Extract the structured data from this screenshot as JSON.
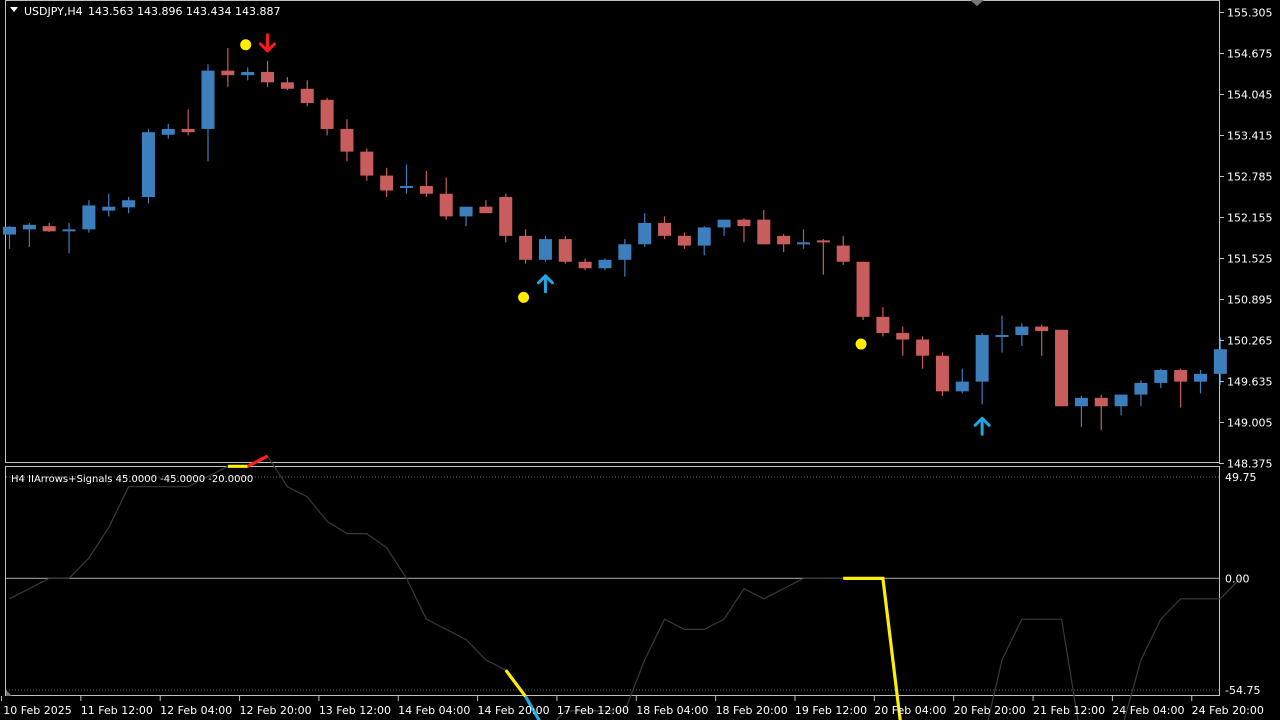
{
  "window": {
    "symbol_label": "USDJPY,H4",
    "ohlc_label": "143.563 143.896 143.434 143.887",
    "dropdown_icon": "triangle-down-icon"
  },
  "indicator": {
    "label": "H4 IIArrows+Signals 45.0000 -45.0000 -20.0000",
    "levels": [
      49.75,
      0,
      -54.75
    ],
    "level_labels": [
      "49.75",
      "0.00",
      "-54.75"
    ]
  },
  "colors": {
    "background": "#000000",
    "frame": "#c0c0c0",
    "bull": "#3d7ebd",
    "bear": "#c95c5c",
    "up_arrow": "#1ea7e1",
    "down_arrow": "#ff1a1a",
    "dot": "#ffee00",
    "osc_line": "#3a3a3a",
    "osc_yellow": "#ffee00",
    "osc_red": "#ff2020",
    "osc_blue": "#1ea7e1",
    "zero_line": "#8a8a8a",
    "dotted_level": "#666666"
  },
  "price_axis": [
    "155.305",
    "154.675",
    "154.045",
    "153.415",
    "152.785",
    "152.155",
    "151.525",
    "150.895",
    "150.265",
    "149.635",
    "149.005",
    "148.375"
  ],
  "time_axis": [
    "10 Feb 2025",
    "11 Feb 12:00",
    "12 Feb 04:00",
    "12 Feb 20:00",
    "13 Feb 12:00",
    "14 Feb 04:00",
    "14 Feb 20:00",
    "17 Feb 12:00",
    "18 Feb 04:00",
    "18 Feb 20:00",
    "19 Feb 12:00",
    "20 Feb 04:00",
    "20 Feb 20:00",
    "21 Feb 12:00",
    "24 Feb 04:00",
    "24 Feb 20:00"
  ],
  "chart_data": [
    {
      "type": "candlestick",
      "title": "USDJPY,H4",
      "ylim": [
        148.375,
        155.305
      ],
      "candles": [
        {
          "o": 151.87,
          "h": 152.0,
          "l": 151.65,
          "c": 151.99
        },
        {
          "o": 151.95,
          "h": 152.05,
          "l": 151.68,
          "c": 152.02
        },
        {
          "o": 152.0,
          "h": 152.05,
          "l": 151.91,
          "c": 151.92
        },
        {
          "o": 151.95,
          "h": 152.05,
          "l": 151.58,
          "c": 151.95
        },
        {
          "o": 151.95,
          "h": 152.4,
          "l": 151.9,
          "c": 152.32
        },
        {
          "o": 152.24,
          "h": 152.5,
          "l": 152.15,
          "c": 152.3
        },
        {
          "o": 152.29,
          "h": 152.45,
          "l": 152.2,
          "c": 152.4
        },
        {
          "o": 152.45,
          "h": 153.5,
          "l": 152.35,
          "c": 153.45
        },
        {
          "o": 153.41,
          "h": 153.58,
          "l": 153.35,
          "c": 153.5
        },
        {
          "o": 153.5,
          "h": 153.8,
          "l": 153.4,
          "c": 153.45
        },
        {
          "o": 153.5,
          "h": 154.5,
          "l": 153.0,
          "c": 154.4
        },
        {
          "o": 154.4,
          "h": 154.75,
          "l": 154.15,
          "c": 154.33
        },
        {
          "o": 154.33,
          "h": 154.45,
          "l": 154.25,
          "c": 154.38
        },
        {
          "o": 154.38,
          "h": 154.55,
          "l": 154.15,
          "c": 154.22
        },
        {
          "o": 154.22,
          "h": 154.3,
          "l": 154.1,
          "c": 154.12
        },
        {
          "o": 154.12,
          "h": 154.25,
          "l": 153.85,
          "c": 153.9
        },
        {
          "o": 153.95,
          "h": 153.98,
          "l": 153.4,
          "c": 153.5
        },
        {
          "o": 153.5,
          "h": 153.65,
          "l": 153.0,
          "c": 153.15
        },
        {
          "o": 153.15,
          "h": 153.2,
          "l": 152.7,
          "c": 152.78
        },
        {
          "o": 152.78,
          "h": 152.9,
          "l": 152.45,
          "c": 152.55
        },
        {
          "o": 152.6,
          "h": 152.95,
          "l": 152.5,
          "c": 152.62
        },
        {
          "o": 152.62,
          "h": 152.85,
          "l": 152.45,
          "c": 152.5
        },
        {
          "o": 152.5,
          "h": 152.75,
          "l": 152.1,
          "c": 152.15
        },
        {
          "o": 152.15,
          "h": 152.3,
          "l": 152.0,
          "c": 152.3
        },
        {
          "o": 152.3,
          "h": 152.4,
          "l": 152.2,
          "c": 152.2
        },
        {
          "o": 152.45,
          "h": 152.5,
          "l": 151.75,
          "c": 151.85
        },
        {
          "o": 151.85,
          "h": 151.95,
          "l": 151.42,
          "c": 151.48
        },
        {
          "o": 151.48,
          "h": 151.85,
          "l": 151.45,
          "c": 151.8
        },
        {
          "o": 151.8,
          "h": 151.85,
          "l": 151.42,
          "c": 151.45
        },
        {
          "o": 151.45,
          "h": 151.5,
          "l": 151.32,
          "c": 151.35
        },
        {
          "o": 151.35,
          "h": 151.5,
          "l": 151.32,
          "c": 151.48
        },
        {
          "o": 151.48,
          "h": 151.8,
          "l": 151.22,
          "c": 151.72
        },
        {
          "o": 151.72,
          "h": 152.2,
          "l": 151.68,
          "c": 152.05
        },
        {
          "o": 152.05,
          "h": 152.15,
          "l": 151.8,
          "c": 151.85
        },
        {
          "o": 151.85,
          "h": 151.9,
          "l": 151.65,
          "c": 151.7
        },
        {
          "o": 151.7,
          "h": 152.0,
          "l": 151.55,
          "c": 151.98
        },
        {
          "o": 151.98,
          "h": 152.1,
          "l": 151.85,
          "c": 152.1
        },
        {
          "o": 152.1,
          "h": 152.12,
          "l": 151.75,
          "c": 152.0
        },
        {
          "o": 152.1,
          "h": 152.25,
          "l": 151.75,
          "c": 151.72
        },
        {
          "o": 151.85,
          "h": 151.88,
          "l": 151.6,
          "c": 151.72
        },
        {
          "o": 151.72,
          "h": 151.95,
          "l": 151.65,
          "c": 151.75
        },
        {
          "o": 151.78,
          "h": 151.8,
          "l": 151.25,
          "c": 151.75
        },
        {
          "o": 151.7,
          "h": 151.85,
          "l": 151.4,
          "c": 151.45
        },
        {
          "o": 151.45,
          "h": 151.45,
          "l": 150.55,
          "c": 150.6
        },
        {
          "o": 150.6,
          "h": 150.75,
          "l": 150.3,
          "c": 150.35
        },
        {
          "o": 150.35,
          "h": 150.45,
          "l": 150.0,
          "c": 150.25
        },
        {
          "o": 150.25,
          "h": 150.3,
          "l": 149.8,
          "c": 150.0
        },
        {
          "o": 150.0,
          "h": 150.05,
          "l": 149.38,
          "c": 149.45
        },
        {
          "o": 149.45,
          "h": 149.8,
          "l": 149.42,
          "c": 149.6
        },
        {
          "o": 149.6,
          "h": 150.35,
          "l": 149.25,
          "c": 150.32
        },
        {
          "o": 150.32,
          "h": 150.62,
          "l": 150.05,
          "c": 150.32
        },
        {
          "o": 150.32,
          "h": 150.5,
          "l": 150.15,
          "c": 150.45
        },
        {
          "o": 150.45,
          "h": 150.48,
          "l": 150.0,
          "c": 150.38
        },
        {
          "o": 150.4,
          "h": 150.4,
          "l": 149.22,
          "c": 149.22
        },
        {
          "o": 149.22,
          "h": 149.38,
          "l": 148.9,
          "c": 149.35
        },
        {
          "o": 149.35,
          "h": 149.4,
          "l": 148.85,
          "c": 149.22
        },
        {
          "o": 149.22,
          "h": 149.4,
          "l": 149.08,
          "c": 149.4
        },
        {
          "o": 149.4,
          "h": 149.62,
          "l": 149.22,
          "c": 149.58
        },
        {
          "o": 149.58,
          "h": 149.8,
          "l": 149.5,
          "c": 149.78
        },
        {
          "o": 149.78,
          "h": 149.8,
          "l": 149.2,
          "c": 149.6
        },
        {
          "o": 149.6,
          "h": 149.78,
          "l": 149.42,
          "c": 149.72
        },
        {
          "o": 149.72,
          "h": 150.28,
          "l": 149.55,
          "c": 150.1
        }
      ],
      "up_arrows_at": [
        27,
        49
      ],
      "down_arrows_at": [
        13
      ],
      "dots": [
        {
          "i": 12,
          "y": 154.8
        },
        {
          "i": 26,
          "y": 150.9
        },
        {
          "i": 43,
          "y": 150.18
        }
      ]
    },
    {
      "type": "line",
      "title": "H4 IIArrows+Signals 45.0000 -45.0000 -20.0000",
      "ylim": [
        -54.75,
        49.75
      ],
      "values": [
        -10,
        -5,
        0,
        0,
        10,
        25,
        45,
        45,
        45,
        45,
        50,
        55,
        55,
        60,
        45,
        40,
        28,
        22,
        22,
        15,
        0,
        -20,
        -25,
        -30,
        -40,
        -45,
        -58,
        -75,
        -65,
        -65,
        -65,
        -65,
        -40,
        -20,
        -25,
        -25,
        -20,
        -5,
        -10,
        -5,
        0,
        0,
        0,
        0,
        0,
        -80,
        -80,
        -80,
        -82,
        -82,
        -40,
        -20,
        -20,
        -20,
        -80,
        -75,
        -75,
        -40,
        -20,
        -10,
        -10,
        -10,
        0
      ]
    }
  ]
}
